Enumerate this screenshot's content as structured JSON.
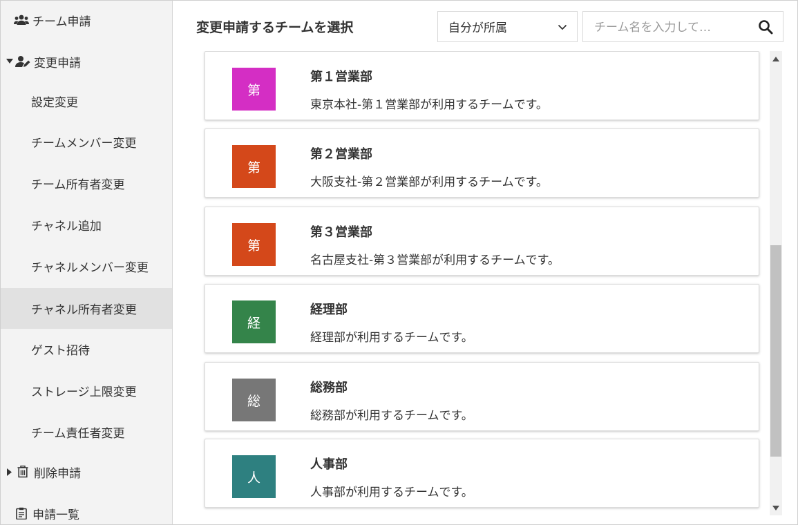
{
  "sidebar": {
    "team_request": "チーム申請",
    "change_request": "変更申請",
    "change_items": [
      {
        "label": "設定変更",
        "active": false
      },
      {
        "label": "チームメンバー変更",
        "active": false
      },
      {
        "label": "チーム所有者変更",
        "active": false
      },
      {
        "label": "チャネル追加",
        "active": false
      },
      {
        "label": "チャネルメンバー変更",
        "active": false
      },
      {
        "label": "チャネル所有者変更",
        "active": true
      },
      {
        "label": "ゲスト招待",
        "active": false
      },
      {
        "label": "ストレージ上限変更",
        "active": false
      },
      {
        "label": "チーム責任者変更",
        "active": false
      }
    ],
    "delete_request": "削除申請",
    "request_list": "申請一覧"
  },
  "header": {
    "title": "変更申請するチームを選択",
    "filter_value": "自分が所属",
    "search_placeholder": "チーム名を入力して…"
  },
  "teams": [
    {
      "initial": "第",
      "name": "第１営業部",
      "description": "東京本社-第１営業部が利用するチームです。",
      "color": "#d42ec4"
    },
    {
      "initial": "第",
      "name": "第２営業部",
      "description": "大阪支社-第２営業部が利用するチームです。",
      "color": "#d4481a"
    },
    {
      "initial": "第",
      "name": "第３営業部",
      "description": "名古屋支社-第３営業部が利用するチームです。",
      "color": "#d4481a"
    },
    {
      "initial": "経",
      "name": "経理部",
      "description": "経理部が利用するチームです。",
      "color": "#34844a"
    },
    {
      "initial": "総",
      "name": "総務部",
      "description": "総務部が利用するチームです。",
      "color": "#777777"
    },
    {
      "initial": "人",
      "name": "人事部",
      "description": "人事部が利用するチームです。",
      "color": "#2e8080"
    }
  ],
  "icons": {
    "team": "team-icon",
    "user_edit": "user-edit-icon",
    "trash": "trash-icon",
    "clipboard": "clipboard-icon",
    "search": "search-icon",
    "chevron": "chevron-down-icon"
  }
}
